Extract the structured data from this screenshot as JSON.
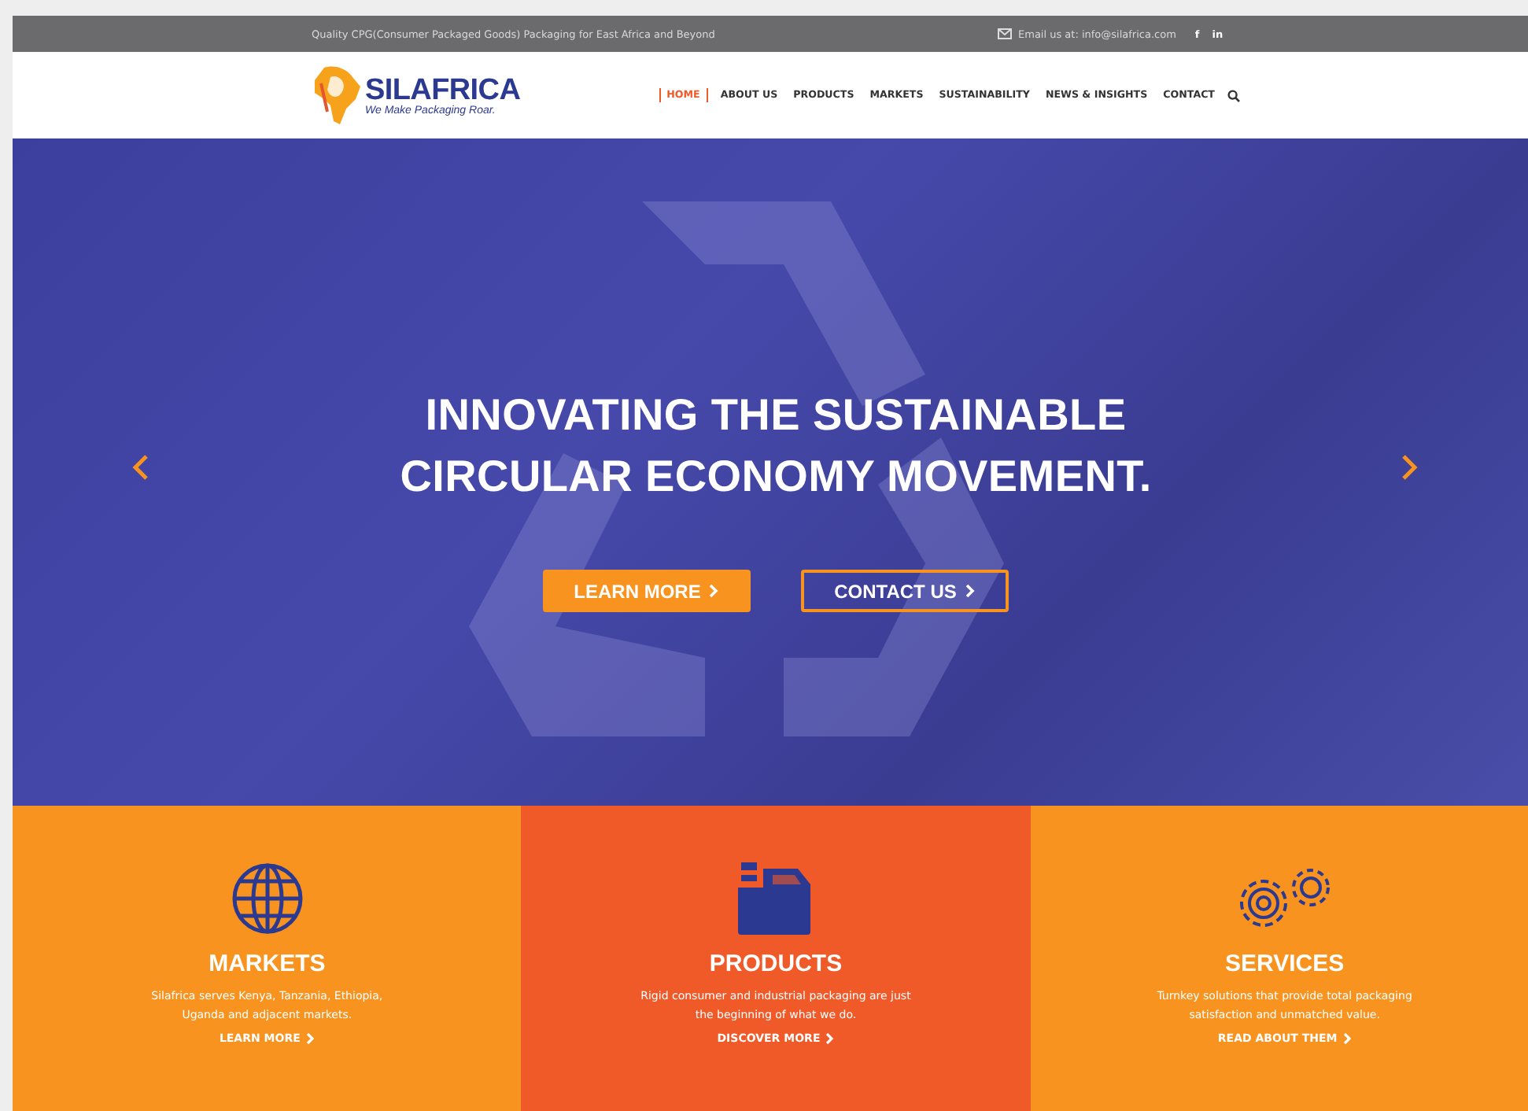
{
  "top_bar": {
    "tagline": "Quality CPG(Consumer Packaged Goods) Packaging for East Africa and Beyond",
    "email": "Email us at: info@silafrica.com",
    "social": [
      "f",
      "in"
    ]
  },
  "header": {
    "logo": {
      "name": "SILAFRICA",
      "slogan": "We Make Packaging Roar."
    },
    "nav": [
      {
        "label": "HOME",
        "selected": true
      },
      {
        "label": "ABOUT US",
        "selected": false
      },
      {
        "label": "PRODUCTS",
        "selected": false
      },
      {
        "label": "MARKETS",
        "selected": false
      },
      {
        "label": "SUSTAINABILITY",
        "selected": false
      },
      {
        "label": "NEWS & INSIGHTS",
        "selected": false
      },
      {
        "label": "CONTACT",
        "selected": false
      }
    ]
  },
  "hero": {
    "title_lines": [
      "INNOVATING THE SUSTAINABLE",
      "CIRCULAR ECONOMY MOVEMENT."
    ],
    "buttons": [
      {
        "label": "LEARN MORE",
        "kind": "filled"
      },
      {
        "label": "CONTACT US",
        "kind": "outline"
      }
    ]
  },
  "cards": [
    {
      "title": "MARKETS",
      "text": "Silafrica serves Kenya, Tanzania, Ethiopia, Uganda and adjacent markets.",
      "link": "LEARN MORE",
      "color": "#f7931e"
    },
    {
      "title": "PRODUCTS",
      "text": "Rigid consumer and industrial packaging are just the beginning of what we do.",
      "link": "DISCOVER MORE",
      "color": "#f05a28"
    },
    {
      "title": "SERVICES",
      "text": "Turnkey solutions that provide total packaging satisfaction and unmatched value.",
      "link": "READ ABOUT THEM",
      "color": "#f7931e"
    }
  ]
}
